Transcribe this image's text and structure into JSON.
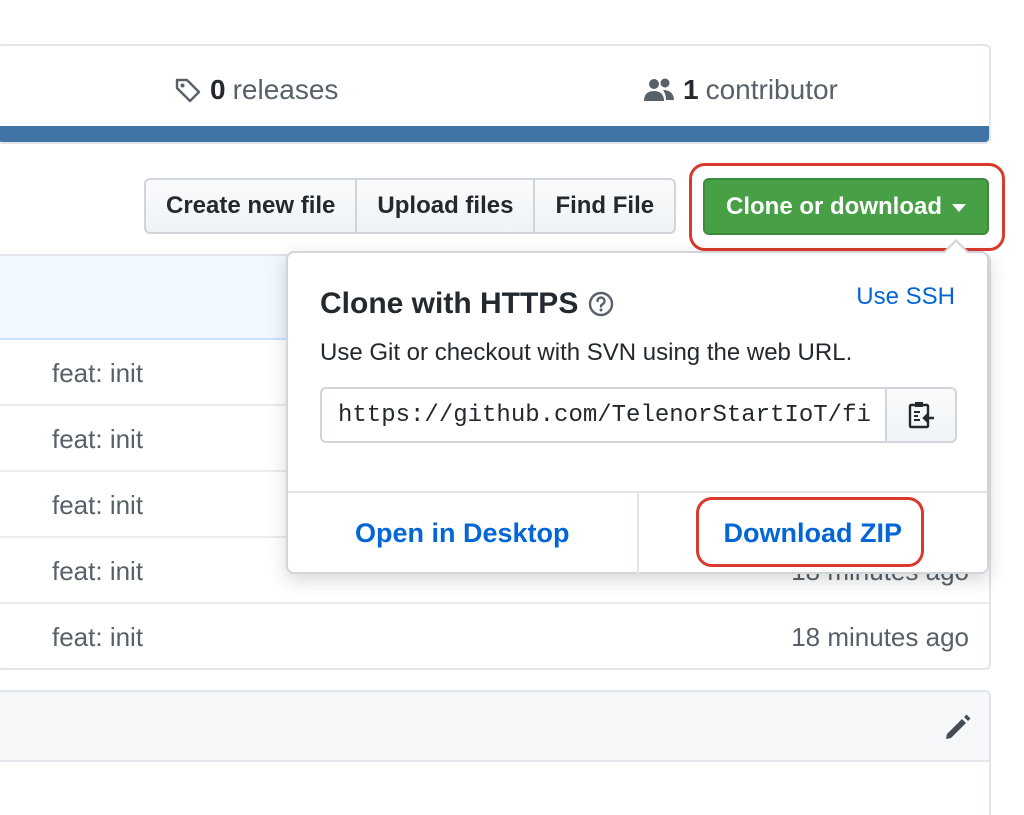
{
  "summary": {
    "releases_count": "0",
    "releases_label": "releases",
    "contributors_count": "1",
    "contributors_label": "contributor",
    "language_bar_color": "#4174a5"
  },
  "toolbar": {
    "create_file": "Create new file",
    "upload_files": "Upload files",
    "find_file": "Find File",
    "clone_download": "Clone or download"
  },
  "files": {
    "rows": [
      {
        "message": "feat: init",
        "age": ""
      },
      {
        "message": "feat: init",
        "age": ""
      },
      {
        "message": "feat: init",
        "age": ""
      },
      {
        "message": "feat: init",
        "age": "18 minutes ago"
      },
      {
        "message": "feat: init",
        "age": "18 minutes ago"
      }
    ]
  },
  "clone_dropdown": {
    "title": "Clone with HTTPS",
    "use_ssh": "Use SSH",
    "description": "Use Git or checkout with SVN using the web URL.",
    "url": "https://github.com/TelenorStartIoT/fi",
    "open_desktop": "Open in Desktop",
    "download_zip": "Download ZIP"
  },
  "colors": {
    "clone_button": "#47a046",
    "link": "#0366d6",
    "highlight_annotation": "#d93a2b"
  }
}
